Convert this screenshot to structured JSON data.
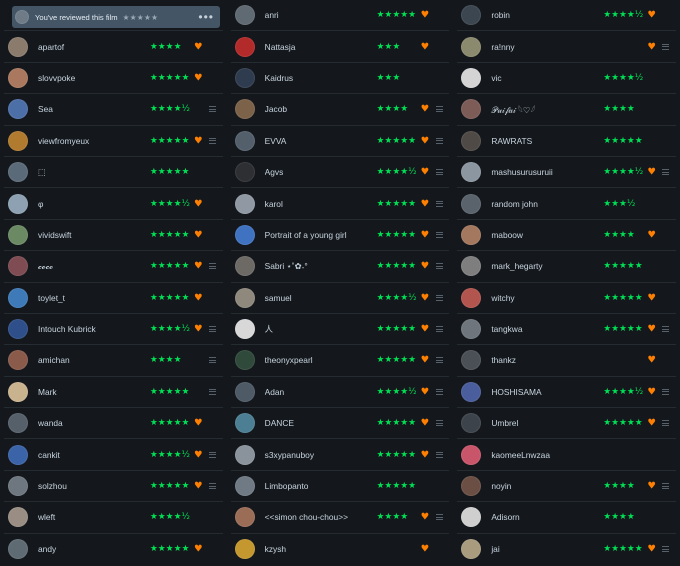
{
  "self_review": {
    "label": "You've reviewed this film",
    "stars": "★★★★★",
    "more": "•••",
    "avatar_color": "#6f7c88"
  },
  "columns": [
    [
      {
        "name": "",
        "rating": "",
        "heart": false,
        "review": false,
        "avatar_color": "#3a4149",
        "is_self_row": true
      },
      {
        "name": "apartof",
        "rating": "★★★★",
        "heart": true,
        "review": false,
        "avatar_color": "#8a7b6d"
      },
      {
        "name": "slovvpoke",
        "rating": "★★★★★",
        "heart": true,
        "review": false,
        "avatar_color": "#a9785e"
      },
      {
        "name": "Sea",
        "rating": "★★★★½",
        "heart": false,
        "review": true,
        "avatar_color": "#4d6fa8"
      },
      {
        "name": "viewfromyeux",
        "rating": "★★★★★",
        "heart": true,
        "review": true,
        "avatar_color": "#b07a2f"
      },
      {
        "name": "⬚",
        "rating": "★★★★★",
        "heart": false,
        "review": false,
        "avatar_color": "#5b6a79"
      },
      {
        "name": "φ",
        "rating": "★★★★½",
        "heart": true,
        "review": false,
        "avatar_color": "#8da1b2"
      },
      {
        "name": "vividswift",
        "rating": "★★★★★",
        "heart": true,
        "review": false,
        "avatar_color": "#6b8a64"
      },
      {
        "name": "𝓬𝓸𝓬𝓸",
        "rating": "★★★★★",
        "heart": true,
        "review": true,
        "avatar_color": "#7e4c52"
      },
      {
        "name": "toylet_t",
        "rating": "★★★★★",
        "heart": true,
        "review": false,
        "avatar_color": "#3e7ab8"
      },
      {
        "name": "Intouch Kubrick",
        "rating": "★★★★½",
        "heart": true,
        "review": true,
        "avatar_color": "#2f4f8a"
      },
      {
        "name": "amichan",
        "rating": "★★★★",
        "heart": false,
        "review": true,
        "avatar_color": "#8a5a4a"
      },
      {
        "name": "Mark",
        "rating": "★★★★★",
        "heart": false,
        "review": true,
        "avatar_color": "#c9b38f"
      },
      {
        "name": "wanda",
        "rating": "★★★★★",
        "heart": true,
        "review": false,
        "avatar_color": "#55606b"
      },
      {
        "name": "cankit",
        "rating": "★★★★½",
        "heart": true,
        "review": true,
        "avatar_color": "#3b63a8"
      },
      {
        "name": "solzhou",
        "rating": "★★★★★",
        "heart": true,
        "review": true,
        "avatar_color": "#6e7780"
      },
      {
        "name": "wleft",
        "rating": "★★★★½",
        "heart": false,
        "review": false,
        "avatar_color": "#9a8e84"
      },
      {
        "name": "andy",
        "rating": "★★★★★",
        "heart": true,
        "review": false,
        "avatar_color": "#5f6b73"
      }
    ],
    [
      {
        "name": "anri",
        "rating": "★★★★★",
        "heart": true,
        "review": false,
        "avatar_color": "#606a72"
      },
      {
        "name": "Nattasja",
        "rating": "★★★",
        "heart": true,
        "review": false,
        "avatar_color": "#b32a2a"
      },
      {
        "name": "Kaidrus",
        "rating": "★★★",
        "heart": false,
        "review": false,
        "avatar_color": "#2f3c4f"
      },
      {
        "name": "Jacob",
        "rating": "★★★★",
        "heart": true,
        "review": true,
        "avatar_color": "#7c6249"
      },
      {
        "name": "EVVA",
        "rating": "★★★★★",
        "heart": true,
        "review": true,
        "avatar_color": "#53606c"
      },
      {
        "name": "Agvs",
        "rating": "★★★★½",
        "heart": true,
        "review": true,
        "avatar_color": "#2d2f33"
      },
      {
        "name": "karol",
        "rating": "★★★★★",
        "heart": true,
        "review": true,
        "avatar_color": "#9099a3"
      },
      {
        "name": "Portrait of a young girl",
        "rating": "★★★★★",
        "heart": true,
        "review": true,
        "avatar_color": "#3f73c2"
      },
      {
        "name": "Sabri ⋆˚✿˖°",
        "rating": "★★★★★",
        "heart": true,
        "review": true,
        "avatar_color": "#6d6a66"
      },
      {
        "name": "samuel",
        "rating": "★★★★½",
        "heart": true,
        "review": true,
        "avatar_color": "#8f887c"
      },
      {
        "name": "人",
        "rating": "★★★★★",
        "heart": true,
        "review": true,
        "avatar_color": "#d8d8d8"
      },
      {
        "name": "theonyxpearl",
        "rating": "★★★★★",
        "heart": true,
        "review": true,
        "avatar_color": "#2f4a3a"
      },
      {
        "name": "Adan",
        "rating": "★★★★½",
        "heart": true,
        "review": true,
        "avatar_color": "#4e5a66"
      },
      {
        "name": "DANCE",
        "rating": "★★★★★",
        "heart": true,
        "review": true,
        "avatar_color": "#4c7f94"
      },
      {
        "name": "s3xypanuboy",
        "rating": "★★★★★",
        "heart": true,
        "review": true,
        "avatar_color": "#8a939c"
      },
      {
        "name": "Limbopanto",
        "rating": "★★★★★",
        "heart": false,
        "review": false,
        "avatar_color": "#6f7a85"
      },
      {
        "name": "<<simon chou-chou>>",
        "rating": "★★★★",
        "heart": true,
        "review": true,
        "avatar_color": "#9b6d57"
      },
      {
        "name": "kzysh",
        "rating": "",
        "heart": true,
        "review": false,
        "avatar_color": "#c4972f"
      }
    ],
    [
      {
        "name": "robin",
        "rating": "★★★★½",
        "heart": true,
        "review": false,
        "avatar_color": "#3c4650"
      },
      {
        "name": "ra!nny",
        "rating": "",
        "heart": true,
        "review": true,
        "avatar_color": "#8b8a6e"
      },
      {
        "name": "vic",
        "rating": "★★★★½",
        "heart": false,
        "review": false,
        "avatar_color": "#d4d4d4"
      },
      {
        "name": "𝒫𝓊𝒾𝒻𝒶𝒾 𓆩♡𓆪",
        "rating": "★★★★",
        "heart": false,
        "review": false,
        "avatar_color": "#7d5c57"
      },
      {
        "name": "RAWRATS",
        "rating": "★★★★★",
        "heart": false,
        "review": false,
        "avatar_color": "#4f4a45"
      },
      {
        "name": "mashusurusuruii",
        "rating": "★★★★½",
        "heart": true,
        "review": true,
        "avatar_color": "#8c96a0"
      },
      {
        "name": "random john",
        "rating": "★★★½",
        "heart": false,
        "review": false,
        "avatar_color": "#5a636c"
      },
      {
        "name": "maboow",
        "rating": "★★★★",
        "heart": true,
        "review": false,
        "avatar_color": "#a3785f"
      },
      {
        "name": "mark_hegarty",
        "rating": "★★★★★",
        "heart": false,
        "review": false,
        "avatar_color": "#7e7e7e"
      },
      {
        "name": "witchy",
        "rating": "★★★★★",
        "heart": true,
        "review": false,
        "avatar_color": "#b2554e"
      },
      {
        "name": "tangkwa",
        "rating": "★★★★★",
        "heart": true,
        "review": true,
        "avatar_color": "#6e757c"
      },
      {
        "name": "thankz",
        "rating": "",
        "heart": true,
        "review": false,
        "avatar_color": "#4b5056"
      },
      {
        "name": "HOSHISAMA",
        "rating": "★★★★½",
        "heart": true,
        "review": true,
        "avatar_color": "#4a5d9c"
      },
      {
        "name": "Umbrel",
        "rating": "★★★★★",
        "heart": true,
        "review": true,
        "avatar_color": "#3d434a"
      },
      {
        "name": "kaomeeLnwzaa",
        "rating": "",
        "heart": false,
        "review": false,
        "avatar_color": "#c9556a"
      },
      {
        "name": "noyin",
        "rating": "★★★★",
        "heart": true,
        "review": true,
        "avatar_color": "#6b4f44"
      },
      {
        "name": "Adisorn",
        "rating": "★★★★",
        "heart": false,
        "review": false,
        "avatar_color": "#cfcfcf"
      },
      {
        "name": "jai",
        "rating": "★★★★★",
        "heart": true,
        "review": true,
        "avatar_color": "#a89b7e"
      }
    ]
  ],
  "heart_symbol": "♥"
}
